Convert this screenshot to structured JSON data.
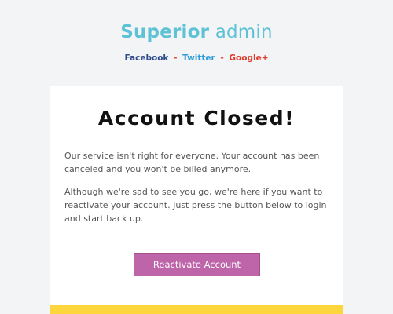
{
  "header": {
    "brand_bold": "Superior",
    "brand_light": "admin",
    "social": [
      {
        "label": "Facebook",
        "color": "#2d4a8a"
      },
      {
        "label": "Twitter",
        "color": "#2f9bd8"
      },
      {
        "label": "Google+",
        "color": "#dd3a2a"
      }
    ],
    "separator": "-"
  },
  "card": {
    "title": "Account Closed!",
    "paragraph1": "Our service isn't right for everyone. Your account has been canceled and you won't be billed anymore.",
    "paragraph2": "Although we're sad to see you go, we're here if you want to reactivate your account. Just press the button below to login and start back up.",
    "button_label": "Reactivate Account"
  },
  "colors": {
    "brand": "#5ec2d6",
    "button": "#bd65a8",
    "footer_bar": "#fdd53c",
    "background": "#f3f4f6"
  }
}
